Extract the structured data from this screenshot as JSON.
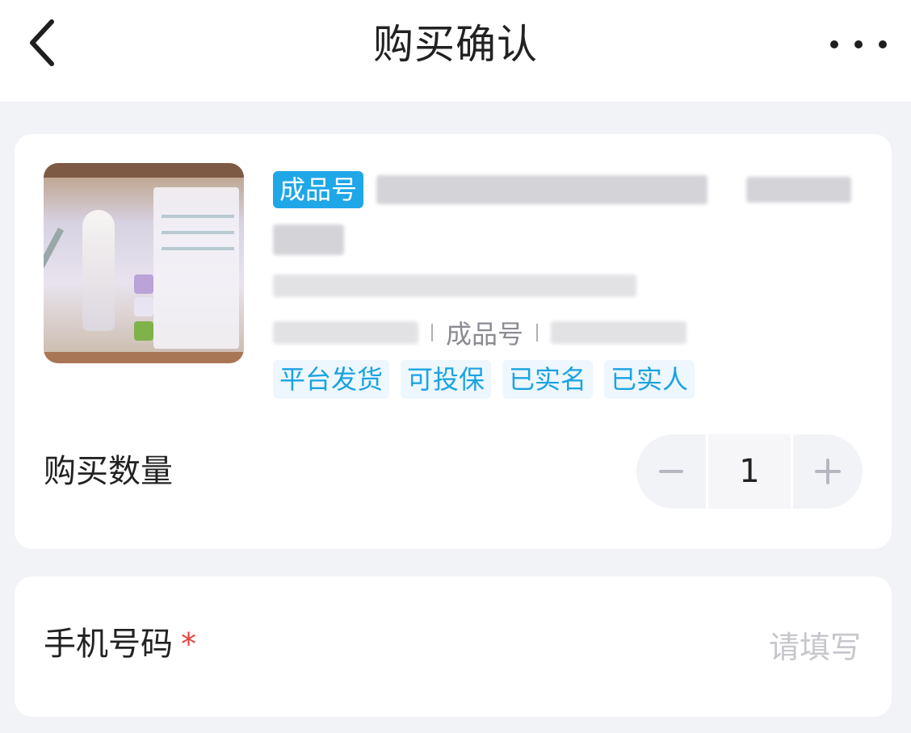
{
  "header": {
    "title": "购买确认",
    "back_icon": "chevron-left-icon",
    "more_icon": "more-horizontal-icon"
  },
  "product": {
    "badge": "成品号",
    "meta_type": "成品号",
    "service_tags": [
      "平台发货",
      "可投保",
      "已实名",
      "已实人"
    ],
    "quantity_label": "购买数量",
    "quantity": "1"
  },
  "phone": {
    "label": "手机号码",
    "required_mark": "*",
    "placeholder": "请填写"
  },
  "colors": {
    "accent": "#1fa7e8",
    "tag_text": "#1aa3e1",
    "required": "#e8413d",
    "page_bg": "#f2f3f7"
  }
}
